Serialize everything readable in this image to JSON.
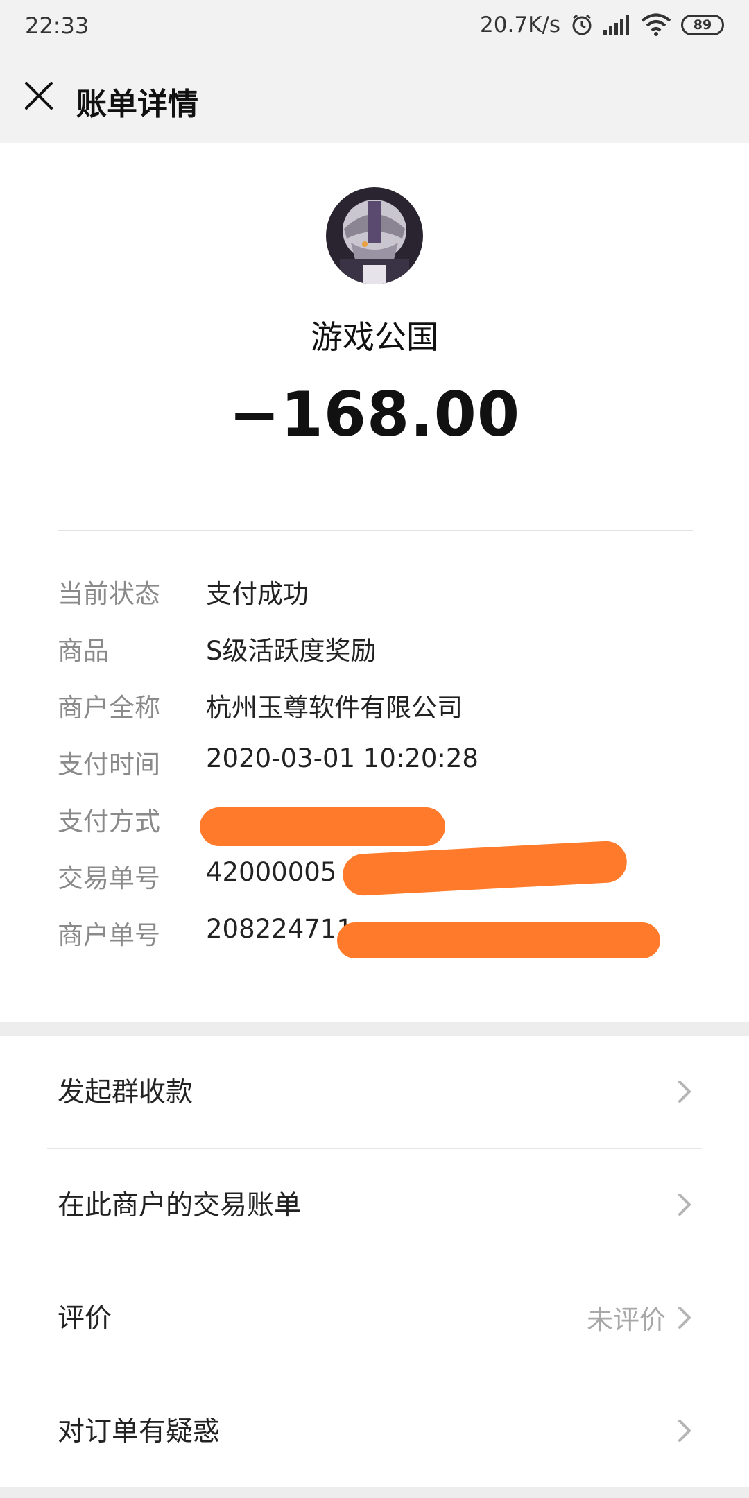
{
  "status_bar": {
    "time": "22:33",
    "net_speed": "20.7K/s",
    "battery": "89"
  },
  "header": {
    "title": "账单详情"
  },
  "merchant": {
    "name": "游戏公国",
    "amount": "−168.00"
  },
  "details": [
    {
      "label": "当前状态",
      "value": "支付成功"
    },
    {
      "label": "商品",
      "value": "S级活跃度奖励"
    },
    {
      "label": "商户全称",
      "value": "杭州玉尊软件有限公司"
    },
    {
      "label": "支付时间",
      "value": "2020-03-01 10:20:28"
    },
    {
      "label": "支付方式",
      "value": ""
    },
    {
      "label": "交易单号",
      "value": "42000005"
    },
    {
      "label": "商户单号",
      "value": "208224711"
    }
  ],
  "menu": [
    {
      "label": "发起群收款",
      "right_text": ""
    },
    {
      "label": "在此商户的交易账单",
      "right_text": ""
    },
    {
      "label": "评价",
      "right_text": "未评价"
    },
    {
      "label": "对订单有疑惑",
      "right_text": ""
    }
  ],
  "colors": {
    "redaction": "#ff7a2a",
    "background": "#ededed"
  }
}
